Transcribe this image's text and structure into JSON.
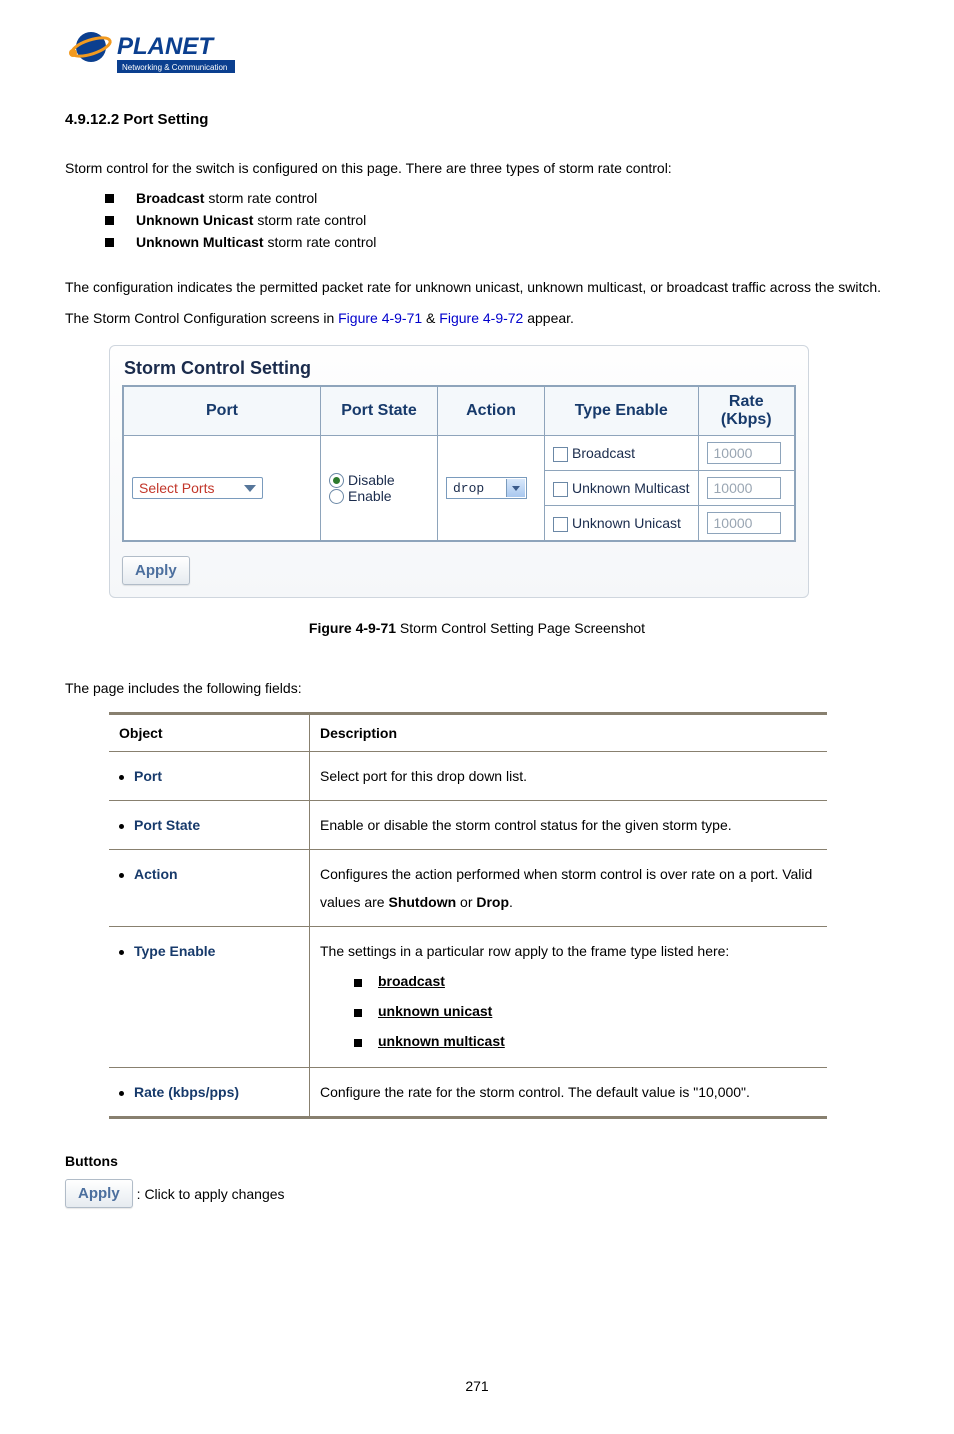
{
  "logo": {
    "brand": "PLANET",
    "tagline": "Networking & Communication"
  },
  "section": {
    "number": "4.9.12.2",
    "title": "Port Setting"
  },
  "intro": {
    "lead": "Storm control for the switch is configured on this page. There are three types of storm rate control:",
    "items": [
      {
        "bold": "Broadcast",
        "rest": " storm rate control"
      },
      {
        "bold": "Unknown Unicast",
        "rest": " storm rate control"
      },
      {
        "bold": "Unknown Multicast",
        "rest": " storm rate control"
      }
    ],
    "config_pre": "The configuration indicates the permitted packet rate for unknown unicast, unknown multicast, or broadcast traffic across the switch. The Storm Control Configuration screens in ",
    "link1": "Figure 4-9-71",
    "between": " & ",
    "link2": "Figure 4-9-72",
    "config_post": " appear."
  },
  "screenshot": {
    "title": "Storm Control Setting",
    "headers": {
      "port": "Port",
      "state": "Port State",
      "action": "Action",
      "type": "Type Enable",
      "rate": "Rate (Kbps)"
    },
    "port_select_label": "Select Ports",
    "state_options": {
      "disable": "Disable",
      "enable": "Enable"
    },
    "action_value": "drop",
    "types": {
      "broadcast": "Broadcast",
      "um": "Unknown Multicast",
      "uu": "Unknown Unicast"
    },
    "rate_value": "10000",
    "apply_label": "Apply"
  },
  "caption": {
    "bold": "Figure 4-9-71",
    "rest": " Storm Control Setting Page Screenshot"
  },
  "fields": {
    "intro": "The page includes the following fields:",
    "headers": {
      "object": "Object",
      "description": "Description"
    },
    "rows": {
      "port": {
        "name": "Port",
        "desc": "Select port for this drop down list."
      },
      "state": {
        "name": "Port State",
        "desc": "Enable or disable the storm control status for the given storm type."
      },
      "action": {
        "name": "Action",
        "desc_pre": "Configures the action performed when storm control is over rate on a port. Valid values are ",
        "b1": "Shutdown",
        "mid": " or ",
        "b2": "Drop",
        "desc_post": "."
      },
      "type": {
        "name": "Type Enable",
        "desc": "The settings in a particular row apply to the frame type listed here:",
        "items": [
          "broadcast",
          "unknown unicast",
          "unknown multicast"
        ]
      },
      "rate": {
        "name": "Rate (kbps/pps)",
        "desc": "Configure the rate for the storm control. The default value is \"10,000\"."
      }
    }
  },
  "buttons": {
    "header": "Buttons",
    "apply_label": "Apply",
    "help": ": Click to apply changes"
  },
  "page_number": "271"
}
